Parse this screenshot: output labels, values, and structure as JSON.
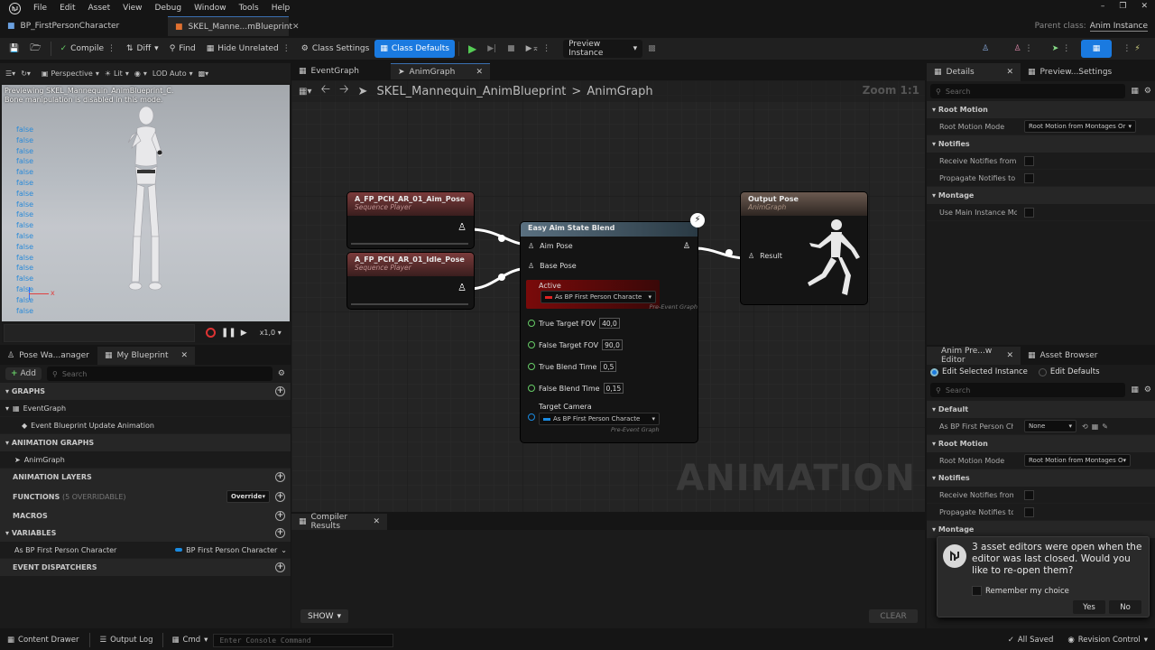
{
  "menubar": {
    "items": [
      "File",
      "Edit",
      "Asset",
      "View",
      "Debug",
      "Window",
      "Tools",
      "Help"
    ]
  },
  "doc_tabs": [
    {
      "label": "BP_FirstPersonCharacter",
      "active": false
    },
    {
      "label": "SKEL_Manne...mBlueprint",
      "active": true
    }
  ],
  "parent_class": {
    "label": "Parent class:",
    "value": "Anim Instance"
  },
  "toolbar": {
    "compile": "Compile",
    "diff": "Diff",
    "find": "Find",
    "hide_unrelated": "Hide Unrelated",
    "class_settings": "Class Settings",
    "class_defaults": "Class Defaults",
    "preview_instance": "Preview Instance"
  },
  "viewport": {
    "perspective": "Perspective",
    "lit": "Lit",
    "lod": "LOD Auto",
    "info_line1": "Previewing SKEL_Mannequin_AnimBlueprint_C.",
    "info_line2": "Bone manipulation is disabled in this mode.",
    "debug_values": [
      "false",
      "false",
      "false",
      "false",
      "false",
      "false",
      "false",
      "false",
      "false",
      "false",
      "false",
      "false",
      "false",
      "false",
      "false",
      "false",
      "false",
      "false"
    ],
    "axis_label": "x",
    "speed": "x1,0"
  },
  "left_tabs": [
    {
      "label": "Pose Wa...anager"
    },
    {
      "label": "My Blueprint"
    }
  ],
  "my_blueprint": {
    "add": "Add",
    "search_placeholder": "Search",
    "graphs_header": "GRAPHS",
    "eventgraph": "EventGraph",
    "event_update": "Event Blueprint Update Animation",
    "anim_graphs_header": "ANIMATION GRAPHS",
    "animgraph": "AnimGraph",
    "anim_layers_header": "ANIMATION LAYERS",
    "functions_header": "FUNCTIONS",
    "functions_count": "(5 OVERRIDABLE)",
    "override": "Override",
    "macros_header": "MACROS",
    "variables_header": "VARIABLES",
    "variable_name": "As BP First Person Character",
    "variable_type": "BP First Person Character",
    "dispatchers_header": "EVENT DISPATCHERS"
  },
  "graph_tabs": [
    {
      "label": "EventGraph"
    },
    {
      "label": "AnimGraph"
    }
  ],
  "breadcrumb": {
    "root": "SKEL_Mannequin_AnimBlueprint",
    "separator": ">",
    "current": "AnimGraph"
  },
  "zoom": "Zoom 1:1",
  "watermark": "ANIMATION",
  "nodes": {
    "aim_pose": {
      "title": "A_FP_PCH_AR_01_Aim_Pose",
      "subtitle": "Sequence Player"
    },
    "idle_pose": {
      "title": "A_FP_PCH_AR_01_Idle_Pose",
      "subtitle": "Sequence Player"
    },
    "blend": {
      "title": "Easy Aim State Blend",
      "aim_pose": "Aim Pose",
      "base_pose": "Base Pose",
      "active": "Active",
      "active_value": "As BP First Person Characte",
      "pre_event": "Pre-Event Graph",
      "true_fov": "True Target FOV",
      "true_fov_value": "40,0",
      "false_fov": "False Target FOV",
      "false_fov_value": "90,0",
      "true_blend": "True Blend Time",
      "true_blend_value": "0,5",
      "false_blend": "False Blend Time",
      "false_blend_value": "0,15",
      "target_camera": "Target Camera",
      "camera_value": "As BP First Person Characte",
      "pre_event2": "Pre-Event Graph"
    },
    "output": {
      "title": "Output Pose",
      "subtitle": "AnimGraph",
      "result": "Result"
    }
  },
  "compiler": {
    "tab": "Compiler Results",
    "show": "SHOW",
    "clear": "CLEAR"
  },
  "details": {
    "tab1": "Details",
    "tab2": "Preview...Settings",
    "search_placeholder": "Search",
    "root_motion_header": "Root Motion",
    "root_motion_mode": "Root Motion Mode",
    "root_motion_value": "Root Motion from Montages Or",
    "notifies_header": "Notifies",
    "receive_notifies": "Receive Notifies from L...",
    "propagate_notifies": "Propagate Notifies to Li...",
    "montage_header": "Montage",
    "use_main_instance": "Use Main Instance Mon..."
  },
  "anim_preview": {
    "tab1": "Anim Pre...w Editor",
    "tab2": "Asset Browser",
    "edit_selected": "Edit Selected Instance",
    "edit_defaults": "Edit Defaults",
    "search_placeholder": "Search",
    "default_header": "Default",
    "as_bp_label": "As BP First Person Cha...",
    "as_bp_value": "None",
    "root_motion_header": "Root Motion",
    "root_motion_mode": "Root Motion Mode",
    "root_motion_value": "Root Motion from Montages O",
    "notifies_header": "Notifies",
    "receive_notifies": "Receive Notifies from...",
    "propagate_notifies": "Propagate Notifies to Li...",
    "montage_header": "Montage"
  },
  "toast": {
    "message": "3 asset editors were open when the editor was last closed. Would you like to re-open them?",
    "remember": "Remember my choice",
    "yes": "Yes",
    "no": "No"
  },
  "statusbar": {
    "content_drawer": "Content Drawer",
    "output_log": "Output Log",
    "cmd": "Cmd",
    "console_placeholder": "Enter Console Command",
    "saved": "All Saved",
    "revision": "Revision Control"
  },
  "colors": {
    "accent_blue": "#0070e0",
    "pose_node": "#7a3b3b",
    "blend_node": "#5a7080",
    "output_node": "#6b5a50",
    "active_red": "#8a1010"
  }
}
